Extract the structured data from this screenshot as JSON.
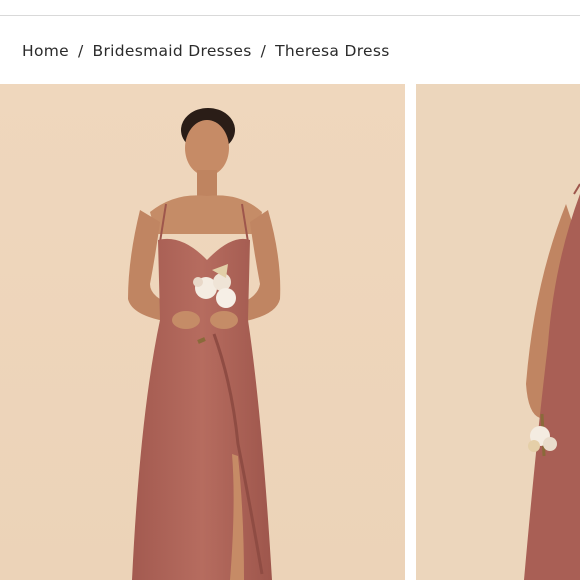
{
  "breadcrumb": {
    "items": [
      "Home",
      "Bridesmaid Dresses"
    ],
    "separator": "/",
    "current": "Theresa Dress"
  },
  "gallery": {
    "main_image": {
      "subject": "model wearing Theresa dress holding bouquet"
    },
    "second_image": {
      "subject": "model wearing Theresa dress side view holding flower"
    }
  },
  "colors": {
    "backdrop": "#efd8bf",
    "dress": "#b0655a",
    "skin": "#c9906c"
  }
}
